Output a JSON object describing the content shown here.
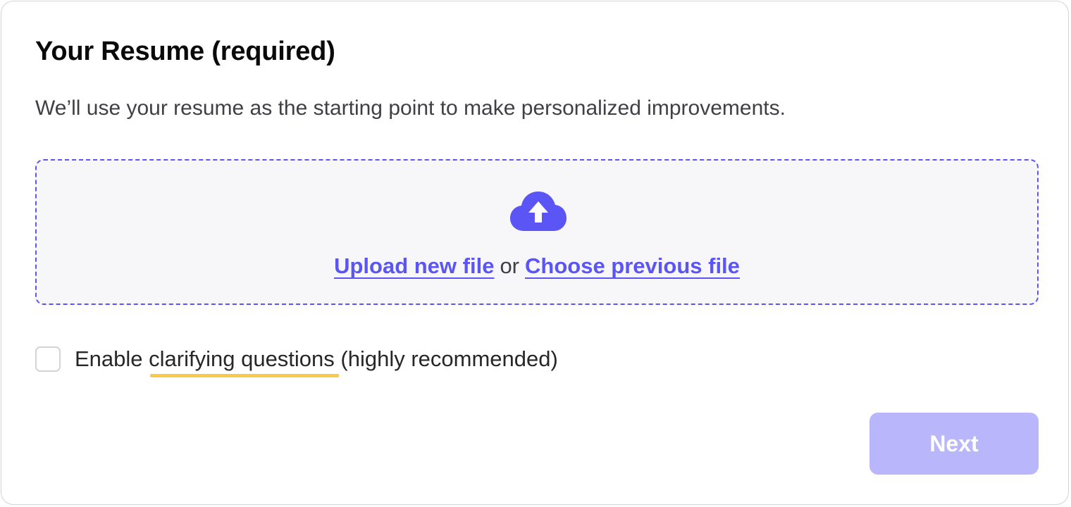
{
  "section": {
    "title": "Your Resume (required)",
    "description": "We’ll use your resume as the starting point to make personalized improvements."
  },
  "dropzone": {
    "icon": "cloud-upload-icon",
    "upload_label": "Upload new file",
    "separator": "or",
    "choose_label": "Choose previous file"
  },
  "clarifying": {
    "checked": false,
    "prefix": "Enable",
    "highlight": "clarifying questions",
    "suffix": "(highly recommended)"
  },
  "actions": {
    "next_label": "Next",
    "next_disabled": true
  },
  "colors": {
    "accent": "#5b55f5",
    "accent_disabled": "#b9b6fb",
    "highlight_underline": "#f8c94a",
    "dropzone_bg": "#f7f7fa",
    "border": "#d4d4d8"
  }
}
